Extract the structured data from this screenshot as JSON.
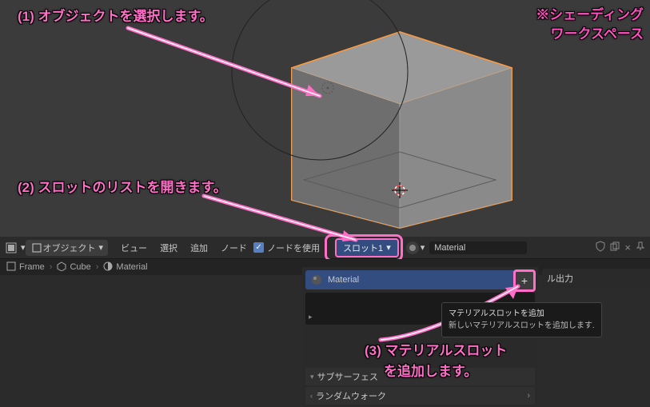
{
  "annotations": {
    "a1": "(1) オブジェクトを選択します。",
    "a2": "(2) スロットのリストを開きます。",
    "a3a": "(3) マテリアルスロット",
    "a3b": "を追加します。",
    "note1": "※シェーディング",
    "note2": "ワークスペース"
  },
  "toolbar": {
    "mode": "オブジェクト",
    "menu_view": "ビュー",
    "menu_select": "選択",
    "menu_add": "追加",
    "menu_node": "ノード",
    "use_nodes": "ノードを使用",
    "slot": "スロット1",
    "material": "Material"
  },
  "breadcrumb": {
    "frame": "Frame",
    "cube": "Cube",
    "material": "Material"
  },
  "panel": {
    "slot_material": "Material",
    "subsurface": "サブサーフェス",
    "random_walk": "ランダムウォーク"
  },
  "mini_panel": {
    "output": "ル出力"
  },
  "tooltip": {
    "title": "マテリアルスロットを追加",
    "desc": "新しいマテリアルスロットを追加します."
  }
}
